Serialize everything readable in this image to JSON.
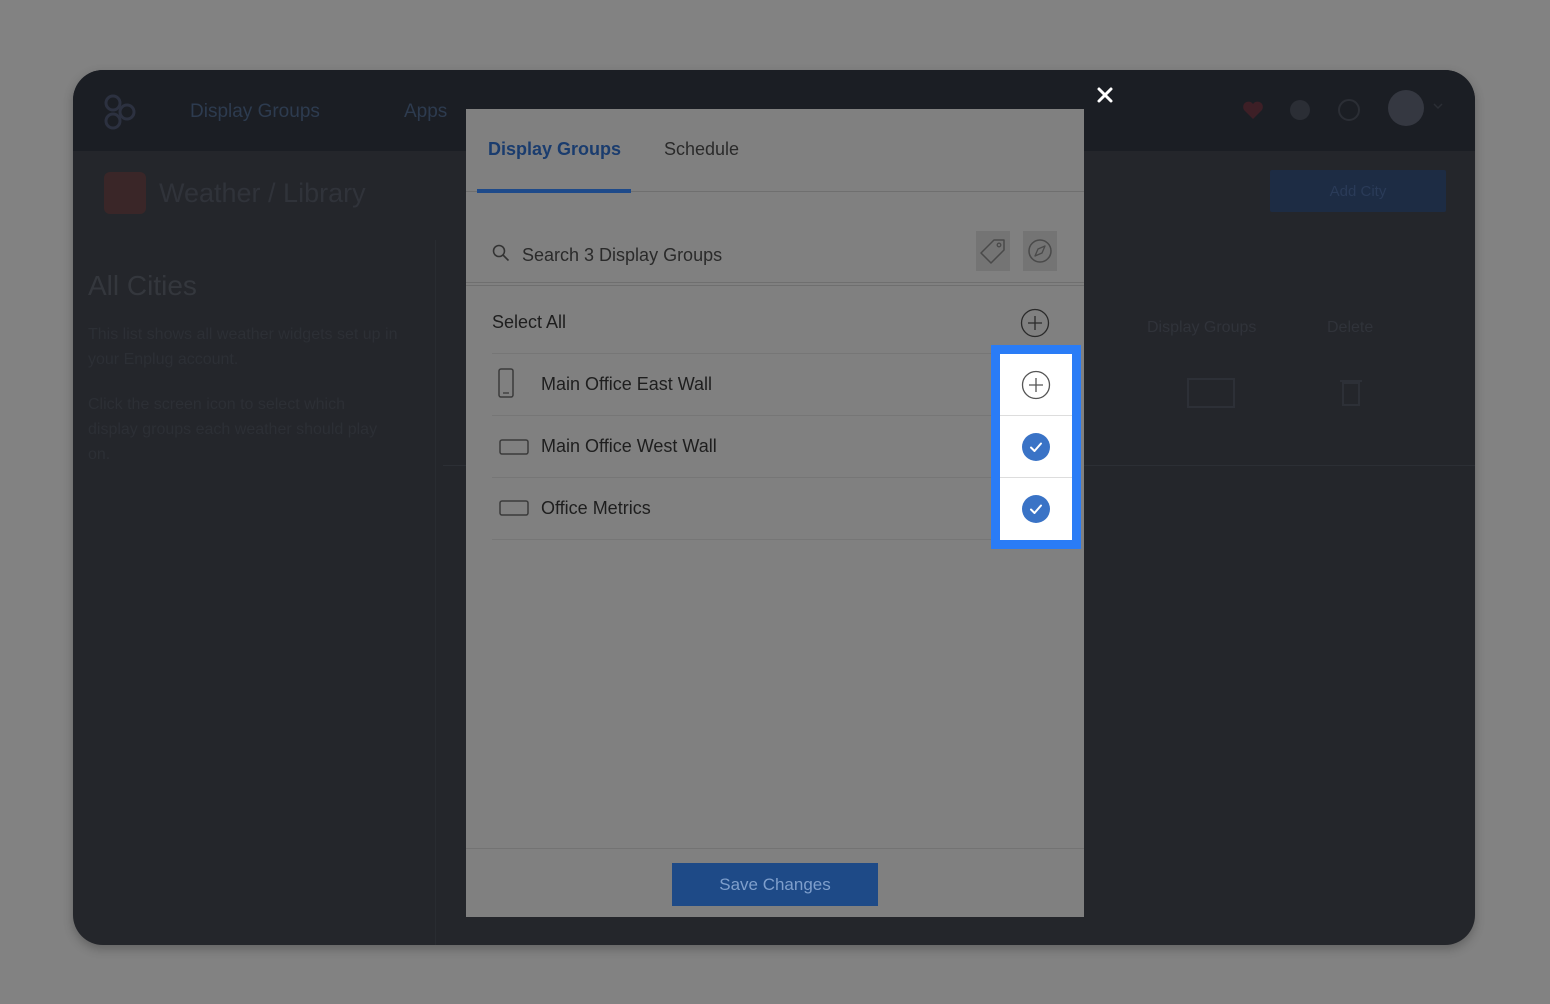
{
  "app": {
    "nav_display_groups": "Display Groups",
    "nav_apps": "Apps",
    "breadcrumb": "Weather / Library",
    "add_city": "Add City",
    "heading": "All Cities",
    "paragraph1": "This list shows all weather widgets set up in your Enplug account.",
    "paragraph2": "Click the screen icon to select which display groups each weather should play on.",
    "col_display_groups": "Display Groups",
    "col_delete": "Delete"
  },
  "modal": {
    "tabs": [
      {
        "label": "Display Groups",
        "active": true
      },
      {
        "label": "Schedule",
        "active": false
      }
    ],
    "search": {
      "placeholder": "Search 3 Display Groups"
    },
    "select_all": "Select All",
    "items": [
      {
        "label": "Main Office East Wall",
        "device": "portrait-device-icon",
        "selected": false
      },
      {
        "label": "Main Office West Wall",
        "device": "landscape-device-icon",
        "selected": true
      },
      {
        "label": "Office Metrics",
        "device": "landscape-device-icon",
        "selected": true
      }
    ],
    "save_label": "Save Changes"
  },
  "colors": {
    "accent": "#1e4a87",
    "highlight_border": "#2a7cf6",
    "check_fill": "#3a73c6",
    "overlay": "#808080"
  }
}
